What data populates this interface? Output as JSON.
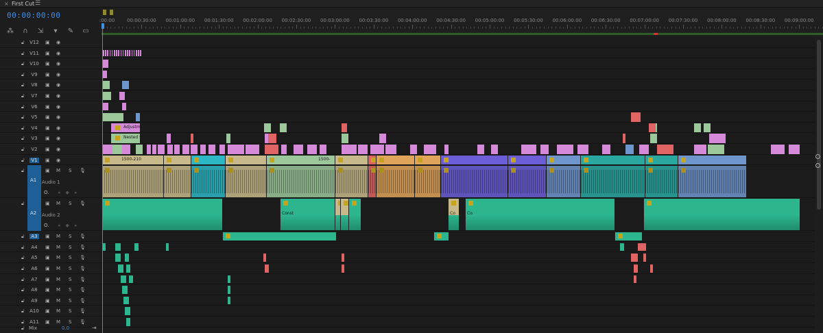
{
  "panel": {
    "close_icon": "×",
    "title": "First Cut",
    "menu_icon": "☰"
  },
  "timecode": "00:00:00:00",
  "tools": [
    {
      "name": "snap-icon",
      "glyph": "⁂"
    },
    {
      "name": "linked-selection-icon",
      "glyph": "∩"
    },
    {
      "name": "selection-tool-icon",
      "glyph": "⇲"
    },
    {
      "name": "marker-icon",
      "glyph": "▾"
    },
    {
      "name": "wrench-icon",
      "glyph": "✎"
    },
    {
      "name": "captions-icon",
      "glyph": "▭"
    }
  ],
  "ruler": {
    "labels": [
      ":00:00",
      "00:00:30:00",
      "00:01:00:00",
      "00:01:30:00",
      "00:02:00:00",
      "00:02:30:00",
      "00:03:00:00",
      "00:03:30:00",
      "00:04:00:00",
      "00:04:30:00",
      "00:05:00:00",
      "00:05:30:00",
      "00:06:00:00",
      "00:06:30:00",
      "00:07:00:00",
      "00:07:30:00",
      "00:08:00:00",
      "00:08:30:00",
      "00:09:00:00"
    ]
  },
  "video_tracks": [
    "V12",
    "V11",
    "V10",
    "V9",
    "V8",
    "V7",
    "V6",
    "V5",
    "V4",
    "V3",
    "V2",
    "V1"
  ],
  "audio_tracks": [
    "A1",
    "A2",
    "A3",
    "A4",
    "A5",
    "A6",
    "A7",
    "A8",
    "A9",
    "A10",
    "A11"
  ],
  "audio_names": {
    "A1": "Audio 1",
    "A2": "Audio 2"
  },
  "track_icons": {
    "lock": "🔓︎",
    "film": "▣",
    "eye": "◉",
    "mute": "M",
    "solo": "S",
    "mic": "🎙︎",
    "volume": "O.",
    "keyframe_nav": "◂◆▸"
  },
  "mix": {
    "label": "Mix",
    "value": "0.0",
    "end_icon": "⇥"
  },
  "clip_labels": {
    "adjustment": "Adjustm",
    "nested": "Nested S",
    "v1_a": "1500-210",
    "v1_b": "1500-",
    "a2_a": "Const",
    "a2_b": "Co",
    "a2_c": "Co"
  },
  "colors": {
    "accent_blue": "#3f8fe6",
    "clip_pink": "#d58ad9",
    "clip_green": "#9cc79a",
    "clip_blue": "#6f95cd",
    "clip_red": "#e06464",
    "clip_tan": "#c7b98a",
    "clip_teal": "#2bb7c4",
    "clip_orange": "#e0a45a",
    "clip_purple": "#6c5ed6",
    "clip_sea": "#2aa8a0",
    "audio_green": "#2db58e"
  }
}
